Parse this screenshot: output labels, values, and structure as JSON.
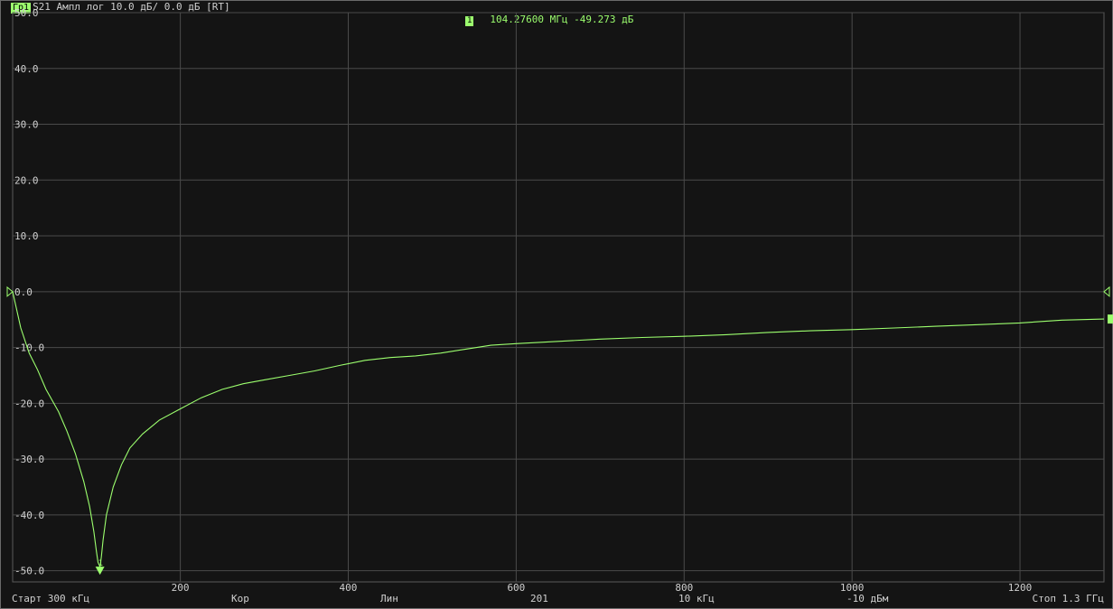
{
  "header": {
    "trace_tag": "Гр1",
    "text": "S21 Ампл лог 10.0 дБ/ 0.0 дБ [RT]"
  },
  "marker": {
    "number": "1",
    "readout": "104.27600 МГц -49.273 дБ"
  },
  "status": {
    "start": "Старт 300 кГц",
    "cor": "Кор",
    "lin": "Лин",
    "points": "201",
    "ifbw": "10 кГц",
    "power": "-10 дБм",
    "stop": "Стоп 1.3 ГГц"
  },
  "colors": {
    "trace": "#9cff6e",
    "grid": "#4a4a4a",
    "background": "#141414"
  },
  "chart_data": {
    "type": "line",
    "title": "",
    "xlabel": "",
    "ylabel": "",
    "xlim": [
      0.3,
      1300
    ],
    "ylim": [
      -52,
      50
    ],
    "grid": true,
    "x_ticks": [
      200,
      400,
      600,
      800,
      1000,
      1200
    ],
    "x_tick_labels": [
      "200",
      "400",
      "600",
      "800",
      "1000",
      "1200"
    ],
    "y_ticks": [
      50,
      40,
      30,
      20,
      10,
      0,
      -10,
      -20,
      -30,
      -40,
      -50
    ],
    "y_tick_labels": [
      "50.0",
      "40.0",
      "30.0",
      "20.0",
      "10.0",
      "0.0",
      "-10.0",
      "-20.0",
      "-30.0",
      "-40.0",
      "-50.0"
    ],
    "reference_level": 0,
    "series": [
      {
        "x": [
          0.3,
          10,
          20,
          30,
          40,
          55,
          65,
          75,
          85,
          92,
          97,
          100,
          102,
          104.3,
          106,
          108,
          112,
          120,
          130,
          140,
          155,
          175,
          200,
          225,
          250,
          275,
          300,
          330,
          360,
          390,
          420,
          450,
          480,
          510,
          540,
          570,
          600,
          650,
          700,
          750,
          800,
          850,
          900,
          950,
          1000,
          1050,
          1100,
          1150,
          1200,
          1250,
          1300
        ],
        "y": [
          0,
          -6.5,
          -11,
          -14,
          -17.5,
          -21.5,
          -25,
          -29,
          -34,
          -38.5,
          -43,
          -46.5,
          -48.5,
          -49.3,
          -47.5,
          -44.5,
          -40,
          -35,
          -31,
          -28,
          -25.5,
          -23,
          -21,
          -19,
          -17.5,
          -16.5,
          -15.8,
          -15,
          -14.2,
          -13.2,
          -12.3,
          -11.8,
          -11.5,
          -11,
          -10.3,
          -9.6,
          -9.3,
          -8.9,
          -8.5,
          -8.2,
          -8,
          -7.7,
          -7.3,
          -7,
          -6.8,
          -6.5,
          -6.2,
          -5.9,
          -5.6,
          -5.1,
          -4.9
        ]
      }
    ],
    "markers": [
      {
        "label": "1",
        "x": 104.276,
        "y": -49.273
      }
    ]
  }
}
